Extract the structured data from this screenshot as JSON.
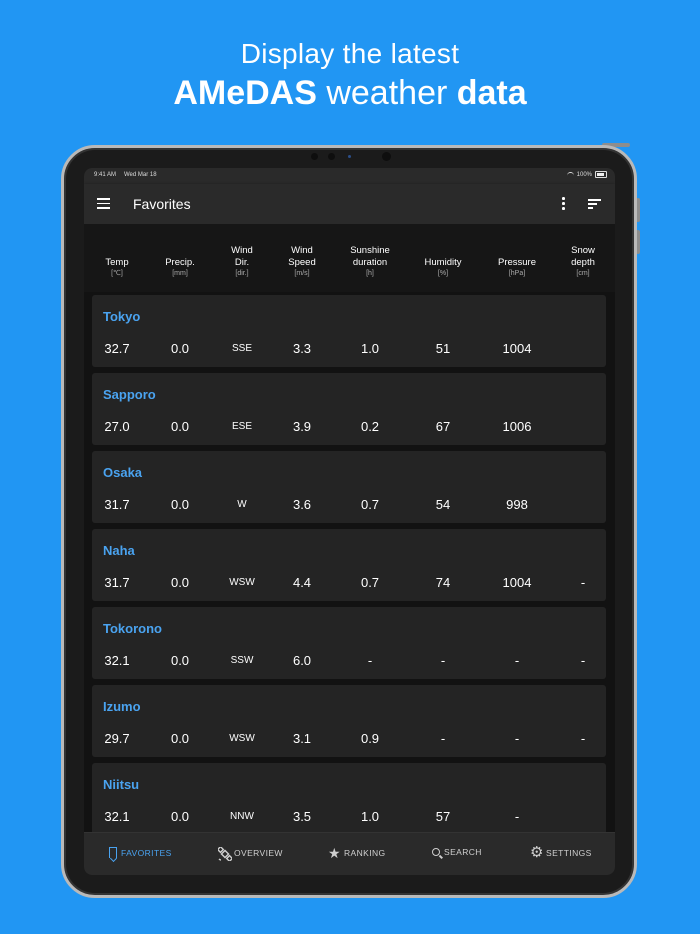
{
  "promo": {
    "line1": "Display the latest",
    "line2_bold1": "AMeDAS",
    "line2_mid": " weather ",
    "line2_bold2": "data"
  },
  "status": {
    "time": "9:41 AM",
    "date": "Wed Mar 18",
    "battery": "100%"
  },
  "appbar": {
    "title": "Favorites"
  },
  "columns": [
    {
      "label": "Temp",
      "unit": "[℃]"
    },
    {
      "label": "Precip.",
      "unit": "[mm]"
    },
    {
      "label": "Wind\nDir.",
      "unit": "[dir.]"
    },
    {
      "label": "Wind\nSpeed",
      "unit": "[m/s]"
    },
    {
      "label": "Sunshine\nduration",
      "unit": "[h]"
    },
    {
      "label": "Humidity",
      "unit": "[%]"
    },
    {
      "label": "Pressure",
      "unit": "[hPa]"
    },
    {
      "label": "Snow\ndepth",
      "unit": "[cm]"
    }
  ],
  "stations": [
    {
      "name": "Tokyo",
      "values": [
        "32.7",
        "0.0",
        "SSE",
        "3.3",
        "1.0",
        "51",
        "1004",
        ""
      ]
    },
    {
      "name": "Sapporo",
      "values": [
        "27.0",
        "0.0",
        "ESE",
        "3.9",
        "0.2",
        "67",
        "1006",
        ""
      ]
    },
    {
      "name": "Osaka",
      "values": [
        "31.7",
        "0.0",
        "W",
        "3.6",
        "0.7",
        "54",
        "998",
        ""
      ]
    },
    {
      "name": "Naha",
      "values": [
        "31.7",
        "0.0",
        "WSW",
        "4.4",
        "0.7",
        "74",
        "1004",
        "-"
      ]
    },
    {
      "name": "Tokorono",
      "values": [
        "32.1",
        "0.0",
        "SSW",
        "6.0",
        "-",
        "-",
        "-",
        "-"
      ]
    },
    {
      "name": "Izumo",
      "values": [
        "29.7",
        "0.0",
        "WSW",
        "3.1",
        "0.9",
        "-",
        "-",
        "-"
      ]
    },
    {
      "name": "Niitsu",
      "values": [
        "32.1",
        "0.0",
        "NNW",
        "3.5",
        "1.0",
        "57",
        "-",
        ""
      ]
    }
  ],
  "nav": {
    "favorites": "FAVORITES",
    "overview": "OVERVIEW",
    "ranking": "RANKING",
    "search": "SEARCH",
    "settings": "SETTINGS"
  },
  "colors": {
    "background": "#2196f3",
    "accent": "#4aa3f0",
    "card": "#242424"
  },
  "icons": [
    "menu-icon",
    "more-vert-icon",
    "sort-icon",
    "bookmark-icon",
    "satellite-icon",
    "star-icon",
    "search-icon",
    "gear-icon"
  ]
}
